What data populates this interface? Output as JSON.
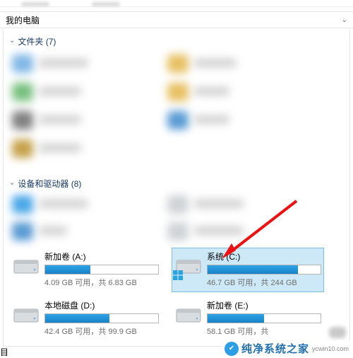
{
  "location_bar": {
    "path": "我的电脑"
  },
  "sections": {
    "folders": {
      "label": "文件夹 (7)"
    },
    "devices": {
      "label": "设备和驱动器 (8)"
    }
  },
  "drives": {
    "a": {
      "title": "新加卷 (A:)",
      "meta": "4.09 GB 可用，共 6.83 GB",
      "fill_pct": 40
    },
    "c": {
      "title": "系统 (C:)",
      "meta": "46.7 GB 可用，共 244 GB",
      "fill_pct": 80,
      "selected": true
    },
    "d": {
      "title": "本地磁盘 (D:)",
      "meta": "42.4 GB 可用，共 99.9 GB",
      "fill_pct": 57
    },
    "e": {
      "title": "新加卷 (E:)",
      "meta": "58.1 GB 可用，共",
      "fill_pct": 50
    }
  },
  "watermark": {
    "brand": "纯净系统之家",
    "url": "ycwin10.com"
  },
  "stray": "目"
}
